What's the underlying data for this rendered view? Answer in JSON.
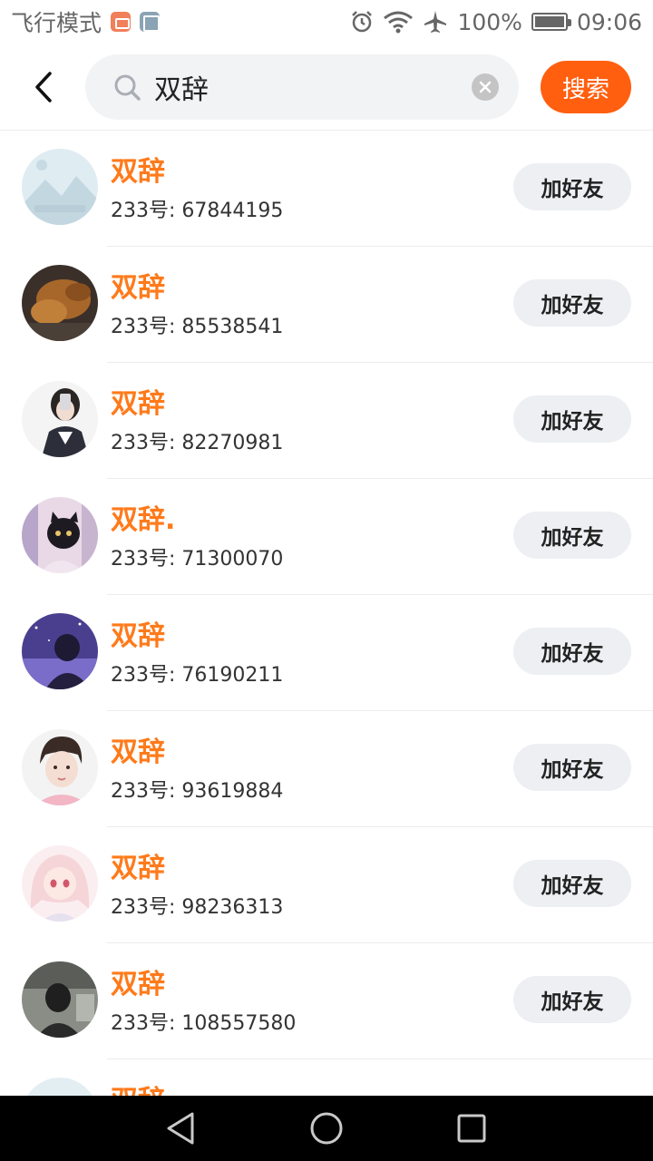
{
  "status_bar": {
    "carrier_text": "飞行模式",
    "battery_text": "100%",
    "time": "09:06"
  },
  "search": {
    "query": "双辞",
    "button_label": "搜索"
  },
  "results": [
    {
      "name": "双辞",
      "id_label": "233号: 67844195",
      "button": "加好友",
      "avatar": "placeholder-image-avatar",
      "avatar_color": "#dfecf2"
    },
    {
      "name": "双辞",
      "id_label": "233号: 85538541",
      "button": "加好友",
      "avatar": "dog-photo-avatar",
      "avatar_color": "#a8672a"
    },
    {
      "name": "双辞",
      "id_label": "233号: 82270981",
      "button": "加好友",
      "avatar": "girl-selfie-avatar",
      "avatar_color": "#f4f4f4"
    },
    {
      "name": "双辞.",
      "id_label": "233号: 71300070",
      "button": "加好友",
      "avatar": "black-cat-avatar",
      "avatar_color": "#e9d8e6"
    },
    {
      "name": "双辞",
      "id_label": "233号: 76190211",
      "button": "加好友",
      "avatar": "night-sky-avatar",
      "avatar_color": "#4a3f8f"
    },
    {
      "name": "双辞",
      "id_label": "233号: 93619884",
      "button": "加好友",
      "avatar": "boy-portrait-avatar",
      "avatar_color": "#f6e0e4"
    },
    {
      "name": "双辞",
      "id_label": "233号: 98236313",
      "button": "加好友",
      "avatar": "anime-girl-avatar",
      "avatar_color": "#f5d5d8"
    },
    {
      "name": "双辞",
      "id_label": "233号: 108557580",
      "button": "加好友",
      "avatar": "dark-photo-avatar",
      "avatar_color": "#5a5d58"
    }
  ],
  "partial_result": {
    "name": "双辞"
  },
  "colors": {
    "accent": "#ff5f0f",
    "name_color": "#ff7a1a",
    "button_bg": "#edeff3"
  }
}
